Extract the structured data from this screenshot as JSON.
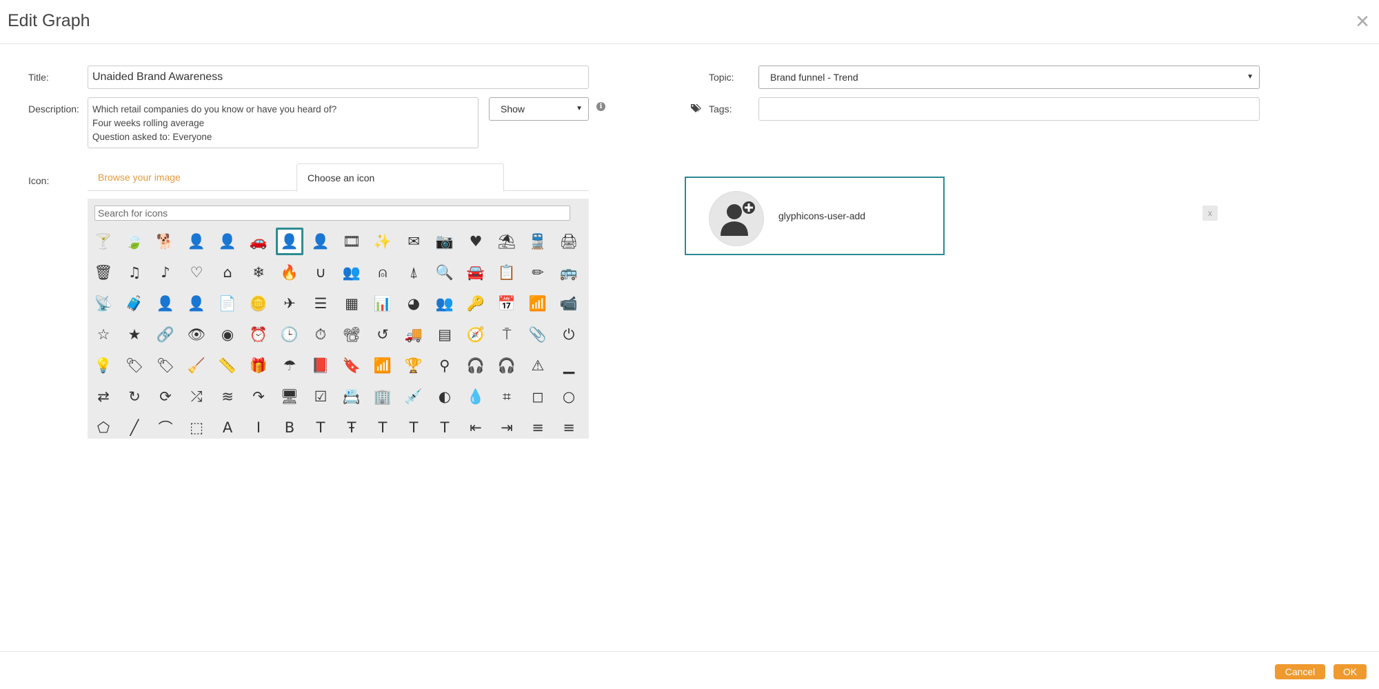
{
  "dialog": {
    "title": "Edit Graph",
    "close_glyph": "×"
  },
  "form": {
    "title_label": "Title:",
    "title_value": "Unaided Brand Awareness",
    "description_label": "Description:",
    "description_lines": [
      "Which retail companies do you know or have you heard of?",
      "Four weeks rolling average",
      "Question asked to: Everyone"
    ],
    "show_select": "Show",
    "info_glyph": "i",
    "topic_label": "Topic:",
    "topic_value": "Brand funnel - Trend",
    "tags_label": "Tags:",
    "tags_value": "",
    "icon_label": "Icon:"
  },
  "tabs": {
    "browse": "Browse your image",
    "choose": "Choose an icon"
  },
  "icon_picker": {
    "search_placeholder": "Search for icons",
    "selected_index": 6,
    "icons": [
      {
        "name": "glass",
        "g": "🍸"
      },
      {
        "name": "leaf",
        "g": "🍃"
      },
      {
        "name": "dog",
        "g": "🐕"
      },
      {
        "name": "user",
        "g": "👤"
      },
      {
        "name": "girl",
        "g": "👤"
      },
      {
        "name": "car",
        "g": "🚗"
      },
      {
        "name": "user-add",
        "g": "👤"
      },
      {
        "name": "user-remove",
        "g": "👤"
      },
      {
        "name": "film",
        "g": "🎞"
      },
      {
        "name": "magic",
        "g": "✨"
      },
      {
        "name": "envelope",
        "g": "✉"
      },
      {
        "name": "camera",
        "g": "📷"
      },
      {
        "name": "heart",
        "g": "♥"
      },
      {
        "name": "beach-umbrella",
        "g": "⛱"
      },
      {
        "name": "train",
        "g": "🚆"
      },
      {
        "name": "print",
        "g": "🖨"
      },
      {
        "name": "bin",
        "g": "🗑"
      },
      {
        "name": "music",
        "g": "♫"
      },
      {
        "name": "note",
        "g": "♪"
      },
      {
        "name": "heart-empty",
        "g": "♡"
      },
      {
        "name": "home",
        "g": "⌂"
      },
      {
        "name": "snowflake",
        "g": "❄"
      },
      {
        "name": "fire",
        "g": "🔥"
      },
      {
        "name": "magnet",
        "g": "∪"
      },
      {
        "name": "parents",
        "g": "👥"
      },
      {
        "name": "binoculars",
        "g": "⍝"
      },
      {
        "name": "road",
        "g": "⍋"
      },
      {
        "name": "search",
        "g": "🔍"
      },
      {
        "name": "cars",
        "g": "🚘"
      },
      {
        "name": "notes",
        "g": "📋"
      },
      {
        "name": "pencil",
        "g": "✏"
      },
      {
        "name": "bus",
        "g": "🚌"
      },
      {
        "name": "wifi-alt",
        "g": "📡"
      },
      {
        "name": "luggage",
        "g": "🧳"
      },
      {
        "name": "old-man",
        "g": "👤"
      },
      {
        "name": "woman",
        "g": "👤"
      },
      {
        "name": "file",
        "g": "📄"
      },
      {
        "name": "coins",
        "g": "🪙"
      },
      {
        "name": "airplane",
        "g": "✈"
      },
      {
        "name": "notes-2",
        "g": "☰"
      },
      {
        "name": "stats",
        "g": "▦"
      },
      {
        "name": "charts",
        "g": "📊"
      },
      {
        "name": "pie-chart",
        "g": "◕"
      },
      {
        "name": "group",
        "g": "👥"
      },
      {
        "name": "keys",
        "g": "🔑"
      },
      {
        "name": "calendar",
        "g": "📅"
      },
      {
        "name": "router",
        "g": "📶"
      },
      {
        "name": "camera-small",
        "g": "📹"
      },
      {
        "name": "star-empty",
        "g": "☆"
      },
      {
        "name": "star",
        "g": "★"
      },
      {
        "name": "link",
        "g": "🔗"
      },
      {
        "name": "eye-open",
        "g": "👁"
      },
      {
        "name": "eye-close",
        "g": "◉"
      },
      {
        "name": "alarm",
        "g": "⏰"
      },
      {
        "name": "clock",
        "g": "🕒"
      },
      {
        "name": "stopwatch",
        "g": "⏱"
      },
      {
        "name": "projector",
        "g": "📽"
      },
      {
        "name": "history",
        "g": "↺"
      },
      {
        "name": "truck",
        "g": "🚚"
      },
      {
        "name": "cargo",
        "g": "▤"
      },
      {
        "name": "compass",
        "g": "🧭"
      },
      {
        "name": "keynote",
        "g": "⍑"
      },
      {
        "name": "paperclip",
        "g": "📎"
      },
      {
        "name": "power",
        "g": "⏻"
      },
      {
        "name": "lightbulb",
        "g": "💡"
      },
      {
        "name": "tag",
        "g": "🏷"
      },
      {
        "name": "tags",
        "g": "🏷"
      },
      {
        "name": "cleaning",
        "g": "🧹"
      },
      {
        "name": "ruler",
        "g": "📏"
      },
      {
        "name": "gift",
        "g": "🎁"
      },
      {
        "name": "umbrella",
        "g": "☂"
      },
      {
        "name": "book",
        "g": "📕"
      },
      {
        "name": "bookmark",
        "g": "🔖"
      },
      {
        "name": "wifi",
        "g": "📶"
      },
      {
        "name": "cup",
        "g": "🏆"
      },
      {
        "name": "stroller",
        "g": "⚲"
      },
      {
        "name": "headphones",
        "g": "🎧"
      },
      {
        "name": "headset",
        "g": "🎧"
      },
      {
        "name": "warning-sign",
        "g": "⚠"
      },
      {
        "name": "signal",
        "g": "▁"
      },
      {
        "name": "retweet",
        "g": "⇄"
      },
      {
        "name": "refresh",
        "g": "↻"
      },
      {
        "name": "roundabout",
        "g": "⟳"
      },
      {
        "name": "random",
        "g": "⤮"
      },
      {
        "name": "heat",
        "g": "≋"
      },
      {
        "name": "repeat",
        "g": "↷"
      },
      {
        "name": "display",
        "g": "🖥"
      },
      {
        "name": "log-book",
        "g": "☑"
      },
      {
        "name": "address-book",
        "g": "📇"
      },
      {
        "name": "building",
        "g": "🏢"
      },
      {
        "name": "eyedropper",
        "g": "💉"
      },
      {
        "name": "adjust",
        "g": "◐"
      },
      {
        "name": "tint",
        "g": "💧"
      },
      {
        "name": "crop",
        "g": "⌗"
      },
      {
        "name": "vector-path-square",
        "g": "◻"
      },
      {
        "name": "vector-path-circle",
        "g": "○"
      },
      {
        "name": "vector-path-polygon",
        "g": "⬠"
      },
      {
        "name": "vector-path-line",
        "g": "╱"
      },
      {
        "name": "vector-path-curve",
        "g": "⌒"
      },
      {
        "name": "vector-path-all",
        "g": "⬚"
      },
      {
        "name": "font",
        "g": "A"
      },
      {
        "name": "italic",
        "g": "I"
      },
      {
        "name": "bold",
        "g": "B"
      },
      {
        "name": "text-underline",
        "g": "T"
      },
      {
        "name": "text-strike",
        "g": "Ŧ"
      },
      {
        "name": "text-height",
        "g": "T"
      },
      {
        "name": "text-size",
        "g": "T"
      },
      {
        "name": "text-resize",
        "g": "T"
      },
      {
        "name": "left-indent",
        "g": "⇤"
      },
      {
        "name": "right-indent",
        "g": "⇥"
      },
      {
        "name": "align-left",
        "g": "≡"
      },
      {
        "name": "align-center",
        "g": "≡"
      }
    ]
  },
  "preview": {
    "icon_name": "glyphicons-user-add",
    "clear_glyph": "x"
  },
  "footer": {
    "cancel_label": "Cancel",
    "ok_label": "OK"
  },
  "colors": {
    "accent_orange": "#ef9a2e",
    "teal_border": "#2a8a92"
  }
}
